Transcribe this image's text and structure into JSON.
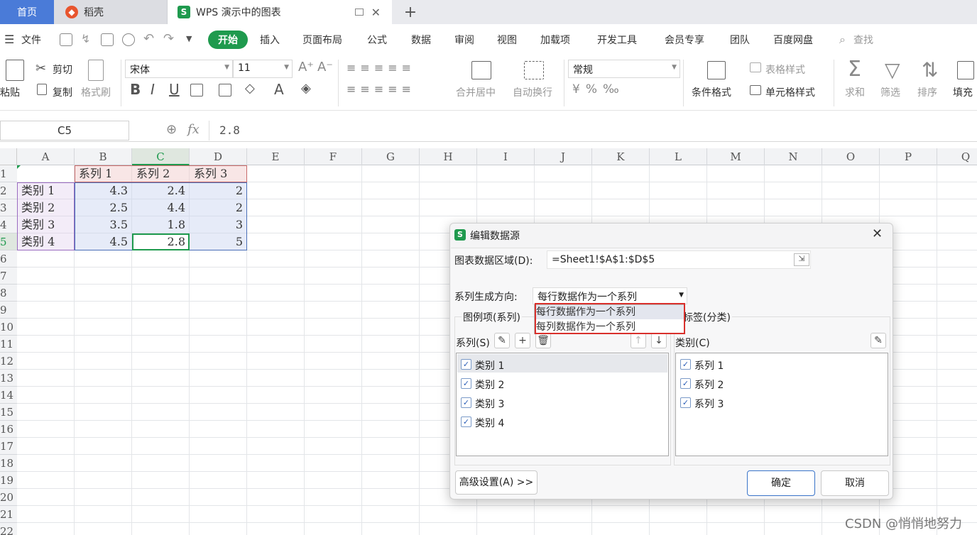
{
  "tabs": {
    "home": "首页",
    "docer": "稻壳",
    "doc": "WPS 演示中的图表",
    "add": "+"
  },
  "menu": {
    "file": "文件",
    "items": [
      "开始",
      "插入",
      "页面布局",
      "公式",
      "数据",
      "审阅",
      "视图",
      "加载项",
      "开发工具",
      "会员专享",
      "团队",
      "百度网盘"
    ],
    "search": "查找"
  },
  "ribbon": {
    "paste": "粘贴",
    "cut": "剪切",
    "copy": "复制",
    "format_painter": "格式刷",
    "font": "宋体",
    "size": "11",
    "merge": "合并居中",
    "wrap": "自动换行",
    "number_format": "常规",
    "cond_format": "条件格式",
    "table_style": "表格样式",
    "cell_style": "单元格样式",
    "sum": "求和",
    "filter": "筛选",
    "sort": "排序",
    "fill": "填充"
  },
  "formula_bar": {
    "name_box": "C5",
    "fx": "fx",
    "value": "2.8"
  },
  "sheet": {
    "columns": [
      "A",
      "B",
      "C",
      "D",
      "E",
      "F",
      "G",
      "H",
      "I",
      "J",
      "K",
      "L",
      "M",
      "N",
      "O",
      "P",
      "Q"
    ],
    "rows": [
      "1",
      "2",
      "3",
      "4",
      "5",
      "6",
      "7",
      "8",
      "9",
      "10",
      "11",
      "12",
      "13",
      "14",
      "15",
      "16",
      "17",
      "18",
      "19",
      "20",
      "21",
      "22"
    ],
    "header_row": [
      "系列 1",
      "系列 2",
      "系列 3"
    ],
    "data_rows": [
      {
        "label": "类别 1",
        "values": [
          "4.3",
          "2.4",
          "2"
        ]
      },
      {
        "label": "类别 2",
        "values": [
          "2.5",
          "4.4",
          "2"
        ]
      },
      {
        "label": "类别 3",
        "values": [
          "3.5",
          "1.8",
          "3"
        ]
      },
      {
        "label": "类别 4",
        "values": [
          "4.5",
          "2.8",
          "5"
        ]
      }
    ]
  },
  "dialog": {
    "icon": "S",
    "title": "编辑数据源",
    "range_label": "图表数据区域(D):",
    "range_value": "=Sheet1!$A$1:$D$5",
    "direction_label": "系列生成方向:",
    "direction_value": "每行数据作为一个系列",
    "dropdown_options": [
      "每行数据作为一个系列",
      "每列数据作为一个系列"
    ],
    "legend_group": "图例项(系列)",
    "axis_group": "标签(分类)",
    "series_label": "系列(S)",
    "category_label": "类别(C)",
    "series_items": [
      "类别 1",
      "类别 2",
      "类别 3",
      "类别 4"
    ],
    "category_items": [
      "系列 1",
      "系列 2",
      "系列 3"
    ],
    "advanced": "高级设置(A) >>",
    "ok": "确定",
    "cancel": "取消"
  },
  "watermark": "CSDN @悄悄地努力",
  "colors": {
    "accent_green": "#1f9a4e",
    "home_tab": "#4a7bd8",
    "highlight_red": "#d9302c"
  }
}
